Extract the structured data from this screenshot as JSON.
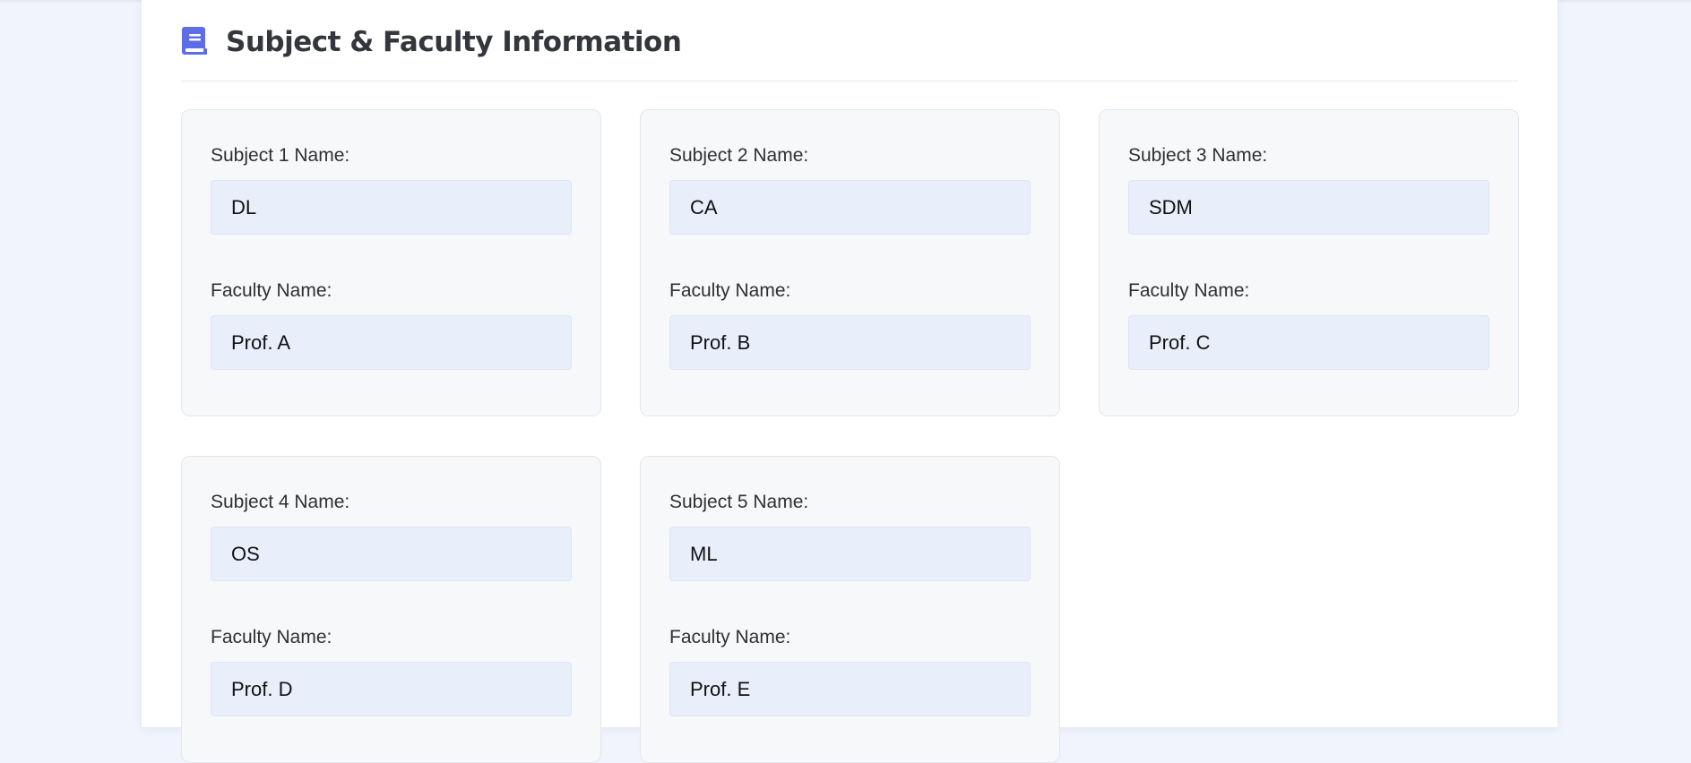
{
  "section": {
    "title": "Subject & Faculty Information",
    "icon": "book-icon",
    "accent_color": "#5b6ee8"
  },
  "subjects": [
    {
      "subject_label": "Subject 1 Name:",
      "subject_value": "DL",
      "faculty_label": "Faculty Name:",
      "faculty_value": "Prof. A"
    },
    {
      "subject_label": "Subject 2 Name:",
      "subject_value": "CA",
      "faculty_label": "Faculty Name:",
      "faculty_value": "Prof. B"
    },
    {
      "subject_label": "Subject 3 Name:",
      "subject_value": "SDM",
      "faculty_label": "Faculty Name:",
      "faculty_value": "Prof. C"
    },
    {
      "subject_label": "Subject 4 Name:",
      "subject_value": "OS",
      "faculty_label": "Faculty Name:",
      "faculty_value": "Prof. D"
    },
    {
      "subject_label": "Subject 5 Name:",
      "subject_value": "ML",
      "faculty_label": "Faculty Name:",
      "faculty_value": "Prof. E"
    }
  ]
}
